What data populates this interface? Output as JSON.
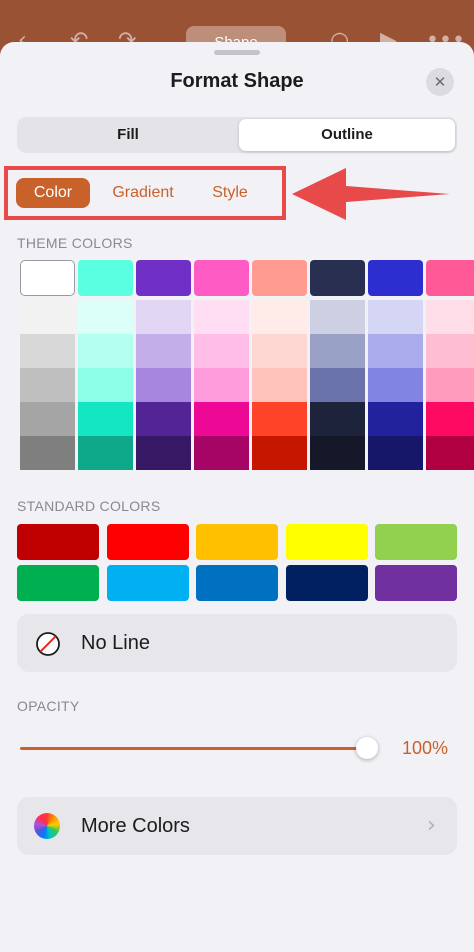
{
  "topbar": {
    "tab_label": "Shape",
    "back_icon": "‹",
    "undo_icon": "↶",
    "redo_icon": "↷",
    "search_icon": "○",
    "play_icon": "▶",
    "more_icon": "•••"
  },
  "sheet": {
    "title": "Format Shape",
    "close_icon": "✕"
  },
  "segments": {
    "fill": "Fill",
    "outline": "Outline",
    "selected": "Outline"
  },
  "subtabs": {
    "items": [
      "Color",
      "Gradient",
      "Style"
    ],
    "selected": "Color"
  },
  "theme_colors": {
    "label": "THEME COLORS",
    "columns": [
      [
        "#ffffff",
        "#f2f2f2",
        "#d8d8d8",
        "#bfbfbf",
        "#a5a5a5",
        "#7f7f7f"
      ],
      [
        "#59ffde",
        "#dcfff8",
        "#b3fff0",
        "#8dffe7",
        "#13e6c0",
        "#0ea88b"
      ],
      [
        "#7030c8",
        "#e1d6f4",
        "#c3aee9",
        "#a686de",
        "#522496",
        "#361864"
      ],
      [
        "#ff5bc4",
        "#ffdef3",
        "#ffbde7",
        "#ff9cdc",
        "#ee0896",
        "#a60566"
      ],
      [
        "#ff9c8f",
        "#ffebe8",
        "#ffd7d2",
        "#ffc3bb",
        "#ff4328",
        "#c71600"
      ],
      [
        "#282f51",
        "#cdd0e3",
        "#9aa1c7",
        "#6a73ab",
        "#1e233c",
        "#141828"
      ],
      [
        "#2c2ed0",
        "#d5d6f6",
        "#abacec",
        "#8284e3",
        "#21229c",
        "#161768"
      ],
      [
        "#ff5a97",
        "#ffdee9",
        "#ffbdd3",
        "#ff9cbd",
        "#ff0a62",
        "#b10041"
      ]
    ]
  },
  "standard_colors": {
    "label": "STANDARD COLORS",
    "rows": [
      [
        "#c00000",
        "#ff0000",
        "#ffc000",
        "#ffff00",
        "#92d050"
      ],
      [
        "#00b050",
        "#00b0f0",
        "#0070c0",
        "#002060",
        "#7030a0"
      ]
    ]
  },
  "no_line": {
    "label": "No Line"
  },
  "opacity": {
    "label": "OPACITY",
    "value_text": "100%",
    "value": 1.0
  },
  "more_colors": {
    "label": "More Colors",
    "chevron": "›"
  },
  "colors": {
    "accent": "#c8612a",
    "annotation": "#e84a4a"
  }
}
